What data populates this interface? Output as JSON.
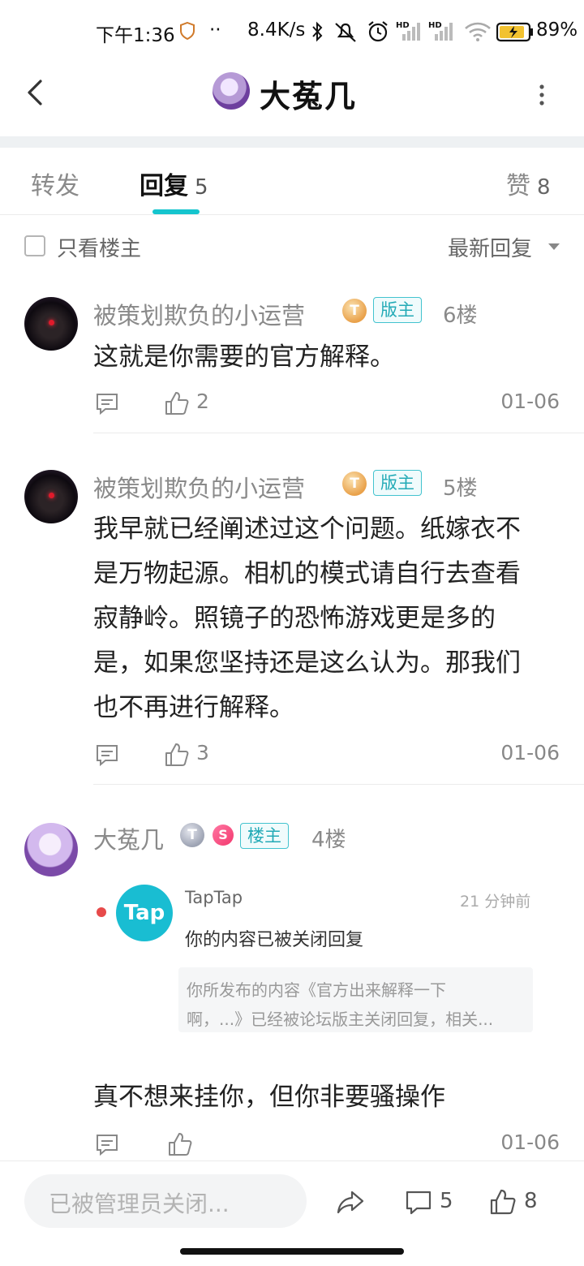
{
  "status_bar": {
    "time": "下午1:36",
    "net_speed": "8.4K/s",
    "battery": "89%",
    "hd1": "HD",
    "hd2": "HD"
  },
  "header": {
    "title": "大菟几"
  },
  "tabs": [
    {
      "label": "转发",
      "count": ""
    },
    {
      "label": "回复",
      "count": "5"
    },
    {
      "label": "赞",
      "count": "8"
    }
  ],
  "filter": {
    "only_op_label": "只看楼主",
    "sort_label": "最新回复"
  },
  "comments": [
    {
      "username": "被策划欺负的小运营",
      "level_icon": "T",
      "badge": "版主",
      "floor": "6楼",
      "text": "这就是你需要的官方解释。",
      "likes": "2",
      "date": "01-06"
    },
    {
      "username": "被策划欺负的小运营",
      "level_icon": "T",
      "badge": "版主",
      "floor": "5楼",
      "text_lines": [
        "我早就已经阐述过这个问题。纸嫁衣不",
        "是万物起源。相机的模式请自行去查看",
        "寂静岭。照镜子的恐怖游戏更是多的",
        "是，如果您坚持还是这么认为。那我们",
        "也不再进行解释。"
      ],
      "likes": "3",
      "date": "01-06"
    },
    {
      "username": "大菟几",
      "level_icon": "T",
      "special_icon": "S",
      "badge": "楼主",
      "floor": "4楼",
      "embed": {
        "logo_text": "Tap",
        "sender": "TapTap",
        "time": "21 分钟前",
        "title": "你的内容已被关闭回复",
        "line1": "你所发布的内容《官方出来解释一下",
        "line2": "啊，...》已经被论坛版主关闭回复，相关..."
      },
      "text": "真不想来挂你，但你非要骚操作",
      "likes": "",
      "date": "01-06"
    }
  ],
  "bottom_bar": {
    "input_placeholder": "已被管理员关闭...",
    "comment_count": "5",
    "like_count": "8"
  },
  "colors": {
    "accent": "#15c5ce",
    "badge_border": "#43c3cf"
  }
}
